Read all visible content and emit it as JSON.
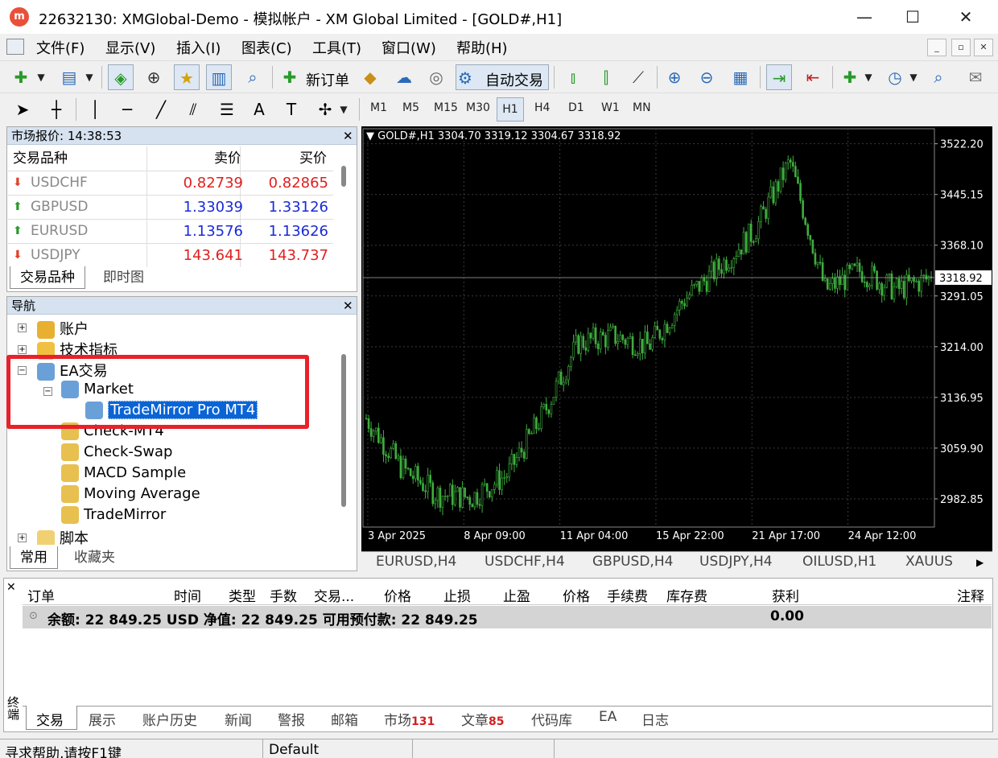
{
  "window": {
    "title": "22632130: XMGlobal-Demo - 模拟帐户 - XM Global Limited - [GOLD#,H1]",
    "logo_text": "m"
  },
  "menu": [
    "文件(F)",
    "显示(V)",
    "插入(I)",
    "图表(C)",
    "工具(T)",
    "窗口(W)",
    "帮助(H)"
  ],
  "toolbar": {
    "new_order": "新订单",
    "auto_trade": "自动交易"
  },
  "timeframes": [
    "M1",
    "M5",
    "M15",
    "M30",
    "H1",
    "H4",
    "D1",
    "W1",
    "MN"
  ],
  "timeframe_selected": "H1",
  "market_watch": {
    "title": "市场报价: 14:38:53",
    "headers": [
      "交易品种",
      "卖价",
      "买价"
    ],
    "rows": [
      {
        "symbol": "USDCHF",
        "bid": "0.82739",
        "ask": "0.82865",
        "dir": "down"
      },
      {
        "symbol": "GBPUSD",
        "bid": "1.33039",
        "ask": "1.33126",
        "dir": "up"
      },
      {
        "symbol": "EURUSD",
        "bid": "1.13576",
        "ask": "1.13626",
        "dir": "up"
      },
      {
        "symbol": "USDJPY",
        "bid": "143.641",
        "ask": "143.737",
        "dir": "down"
      }
    ],
    "tabs": [
      "交易品种",
      "即时图"
    ]
  },
  "navigator": {
    "title": "导航",
    "items": [
      "账户",
      "技术指标",
      "EA交易",
      "Market",
      "TradeMirror Pro MT4",
      "Check-MT4",
      "Check-Swap",
      "MACD Sample",
      "Moving Average",
      "TradeMirror",
      "脚本"
    ],
    "tabs": [
      "常用",
      "收藏夹"
    ]
  },
  "chart": {
    "header": "GOLD#,H1  3304.70 3319.12 3304.67 3318.92",
    "current_price": "3318.92",
    "price_ticks": [
      "3522.20",
      "3445.15",
      "3368.10",
      "3291.05",
      "3214.00",
      "3136.95",
      "3059.90",
      "2982.85"
    ],
    "time_ticks": [
      "3 Apr 2025",
      "8 Apr 09:00",
      "11 Apr 04:00",
      "15 Apr 22:00",
      "21 Apr 17:00",
      "24 Apr 12:00"
    ],
    "colors": {
      "background": "#000000",
      "candle": "#3fae3f",
      "grid": "#3a3a3a",
      "text": "#ffffff"
    }
  },
  "chart_data": {
    "type": "candlestick",
    "title": "GOLD#,H1",
    "ylim": [
      2940,
      3545
    ],
    "x": [
      "3 Apr 2025",
      "4 Apr",
      "7 Apr",
      "8 Apr 09:00",
      "9 Apr",
      "10 Apr",
      "11 Apr 04:00",
      "14 Apr",
      "15 Apr",
      "15 Apr 22:00",
      "17 Apr",
      "18 Apr",
      "21 Apr 17:00",
      "22 Apr",
      "23 Apr",
      "24 Apr 12:00",
      "25 Apr"
    ],
    "close": [
      3105,
      3030,
      2990,
      2985,
      3020,
      3110,
      3220,
      3230,
      3215,
      3285,
      3335,
      3390,
      3495,
      3300,
      3330,
      3300,
      3318.92
    ]
  },
  "chart_tabs": [
    "EURUSD,H4",
    "USDCHF,H4",
    "GBPUSD,H4",
    "USDJPY,H4",
    "OILUSD,H1",
    "XAUUS"
  ],
  "terminal": {
    "side_label": "终端",
    "headers": [
      "订单",
      "时间",
      "类型",
      "手数",
      "交易...",
      "价格",
      "止损",
      "止盈",
      "价格",
      "手续费",
      "库存费",
      "获利",
      "注释"
    ],
    "balance_line": "余额: 22 849.25 USD  净值: 22 849.25  可用预付款: 22 849.25",
    "profit": "0.00",
    "tabs": [
      "交易",
      "展示",
      "账户历史",
      "新闻",
      "警报",
      "邮箱",
      "市场",
      "文章",
      "代码库",
      "EA",
      "日志"
    ],
    "market_count": "131",
    "article_count": "85"
  },
  "status": {
    "help": "寻求帮助,请按F1键",
    "profile": "Default"
  }
}
